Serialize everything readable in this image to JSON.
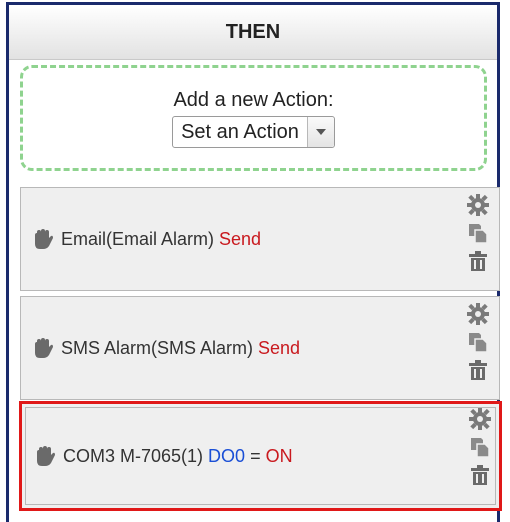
{
  "panel": {
    "title": "THEN"
  },
  "add_action": {
    "label": "Add a new Action:",
    "select_value": "Set an Action"
  },
  "actions": [
    {
      "prefix": "Email(Email Alarm) ",
      "keyword": "Send",
      "selected": false
    },
    {
      "prefix": "SMS Alarm(SMS Alarm) ",
      "keyword": "Send",
      "selected": false
    },
    {
      "prefix": "COM3 M-7065(1) ",
      "target": "DO0",
      "operator": " = ",
      "value": "ON",
      "selected": true
    }
  ],
  "colors": {
    "frame_border": "#1a2a6c",
    "dashed_border": "#8fd38f",
    "selected_border": "#e01818",
    "keyword_red": "#c9191e",
    "target_blue": "#1a4fd6"
  },
  "icons": {
    "drag": "hand-drag-icon",
    "settings": "gear-icon",
    "copy": "copy-icon",
    "delete": "trash-icon"
  }
}
